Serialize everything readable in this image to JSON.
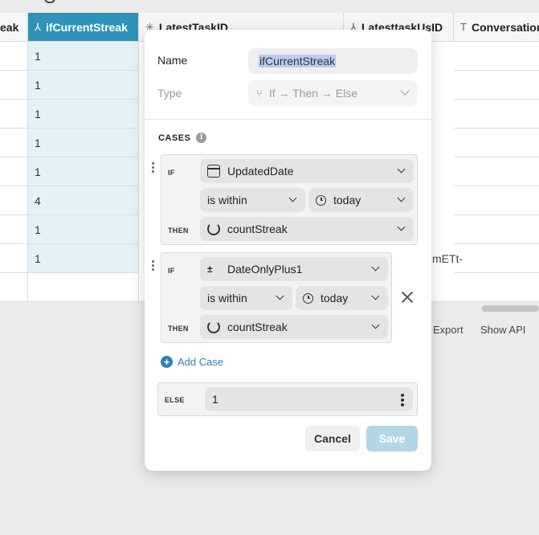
{
  "table": {
    "headers": [
      {
        "label": "eak",
        "icon": ""
      },
      {
        "label": "ifCurrentStreak",
        "icon": "⅄"
      },
      {
        "label": "LatestTaskID",
        "icon": "✳"
      },
      {
        "label": "LatesttaskUsID",
        "icon": "⅄"
      },
      {
        "label": "Conversation",
        "icon": "T"
      }
    ],
    "selected_column_values": [
      "1",
      "1",
      "1",
      "1",
      "1",
      "4",
      "1",
      "1",
      ""
    ],
    "stray_text": "mETt-",
    "footer": {
      "export": "Export",
      "show_api": "Show API"
    }
  },
  "dialog": {
    "name_label": "Name",
    "name_value": "ifCurrentStreak",
    "type_label": "Type",
    "type_value": "If → Then → Else",
    "cases_title": "CASES",
    "info_glyph": "i",
    "if_kw": "IF",
    "then_kw": "THEN",
    "else_kw": "ELSE",
    "cases": [
      {
        "if_column": "UpdatedDate",
        "operator": "is within",
        "value": "today",
        "then_column": "countStreak"
      },
      {
        "if_column": "DateOnlyPlus1",
        "operator": "is within",
        "value": "today",
        "then_column": "countStreak"
      }
    ],
    "add_case_label": "Add Case",
    "else_value": "1",
    "cancel_label": "Cancel",
    "save_label": "Save"
  }
}
